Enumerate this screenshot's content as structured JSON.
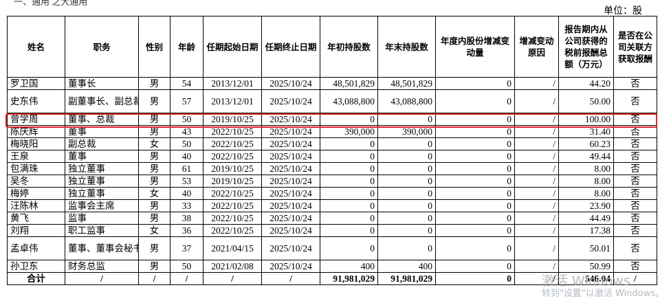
{
  "top_text": "一、通用 之大通用",
  "unit_label": "单位：股",
  "headers": [
    "姓名",
    "职务",
    "性别",
    "年龄",
    "任期起始日期",
    "任期终止日期",
    "年初持股数",
    "年末持股数",
    "年度内股份增减变动量",
    "增减变动原因",
    "报告期内从公司获得的税前报酬总额（万元）",
    "是否在公司关联方获取报酬"
  ],
  "rows": [
    [
      "罗卫国",
      "董事长",
      "男",
      "54",
      "2013/12/01",
      "2025/10/24",
      "48,501,829",
      "48,501,829",
      "0",
      "/",
      "44.20",
      "否"
    ],
    [
      "史东伟",
      "副董事长、副总裁",
      "男",
      "57",
      "2013/12/01",
      "2025/10/24",
      "43,088,800",
      "43,088,800",
      "0",
      "/",
      "50.00",
      "否"
    ],
    [
      "曾学周",
      "董事、总裁",
      "男",
      "50",
      "2019/10/25",
      "2025/10/24",
      "0",
      "0",
      "0",
      "/",
      "100.00",
      "否"
    ],
    [
      "陈庆辉",
      "董事",
      "男",
      "43",
      "2022/10/25",
      "2025/10/24",
      "390,000",
      "390,000",
      "0",
      "/",
      "31.40",
      "否"
    ],
    [
      "梅晓阳",
      "副总裁",
      "女",
      "50",
      "2022/10/25",
      "2025/10/24",
      "0",
      "0",
      "0",
      "/",
      "60.23",
      "否"
    ],
    [
      "王泉",
      "董事",
      "男",
      "40",
      "2022/10/25",
      "2025/10/24",
      "0",
      "0",
      "0",
      "/",
      "49.44",
      "否"
    ],
    [
      "包满珠",
      "独立董事",
      "男",
      "61",
      "2019/10/25",
      "2025/10/24",
      "0",
      "0",
      "0",
      "/",
      "8.00",
      "否"
    ],
    [
      "吴冬",
      "独立董事",
      "男",
      "53",
      "2019/10/25",
      "2025/10/24",
      "0",
      "0",
      "0",
      "/",
      "8.00",
      "否"
    ],
    [
      "梅婷",
      "独立董事",
      "女",
      "40",
      "2022/10/25",
      "2025/10/24",
      "0",
      "0",
      "0",
      "/",
      "8.00",
      "否"
    ],
    [
      "汪陈林",
      "监事会主席",
      "男",
      "33",
      "2022/10/25",
      "2025/10/24",
      "0",
      "0",
      "0",
      "/",
      "23.90",
      "否"
    ],
    [
      "黄飞",
      "监事",
      "男",
      "38",
      "2022/10/25",
      "2025/10/24",
      "0",
      "0",
      "0",
      "/",
      "44.49",
      "否"
    ],
    [
      "刘翔",
      "职工监事",
      "女",
      "36",
      "2022/10/25",
      "2025/10/24",
      "0",
      "0",
      "0",
      "/",
      "17.38",
      "否"
    ],
    [
      "孟卓伟",
      "董事、董事会秘书",
      "男",
      "37",
      "2021/04/15",
      "2025/10/24",
      "0",
      "0",
      "0",
      "/",
      "50.01",
      "否"
    ],
    [
      "孙卫东",
      "财务总监",
      "男",
      "50",
      "2021/02/08",
      "2025/10/24",
      "400",
      "400",
      "0",
      "/",
      "50.99",
      "否"
    ]
  ],
  "total": [
    "合计",
    "/",
    "/",
    "/",
    "/",
    "/",
    "91,981,029",
    "91,981,029",
    "0",
    "/",
    "546.04",
    "/"
  ],
  "watermark": {
    "line1": "激活 Windows",
    "line2": "转到\"设置\"以激活 Windows。"
  },
  "highlight_color": "#e0242a"
}
